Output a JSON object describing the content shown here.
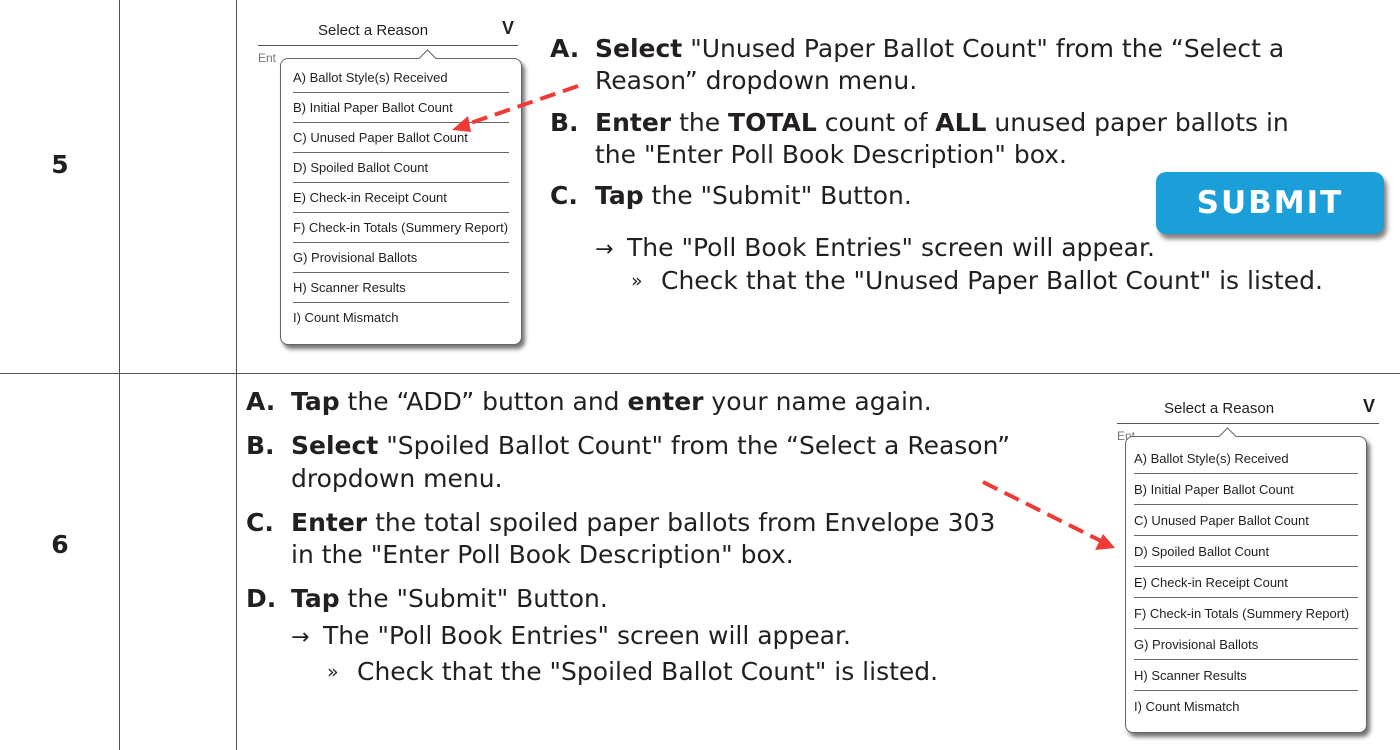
{
  "steps": [
    {
      "number": "5",
      "instructions": [
        {
          "letter": "A.",
          "html": "<b>Select</b> \"Unused Paper Ballot Count\" from the “Select a<br>Reason” dropdown menu."
        },
        {
          "letter": "B.",
          "html": "<b>Enter</b> the <b>TOTAL</b> count of <b>ALL</b> unused paper ballots in<br>the \"Enter Poll Book Description\" box."
        },
        {
          "letter": "C.",
          "html": "<b>Tap</b> the \"Submit\" Button."
        }
      ],
      "result_arrow": "→",
      "result": "The \"Poll Book Entries\" screen will appear.",
      "check_marker": "»",
      "check": "Check that the \"Unused Paper Ballot Count\" is listed.",
      "submit_label": "SUBMIT"
    },
    {
      "number": "6",
      "instructions": [
        {
          "letter": "A.",
          "html": "<b>Tap</b> the “ADD” button and <b>enter</b> your name again."
        },
        {
          "letter": "B.",
          "html": "<b>Select</b> \"Spoiled Ballot Count\" from the “Select a Reason”<br>dropdown menu."
        },
        {
          "letter": "C.",
          "html": "<b>Enter</b> the total spoiled paper ballots from Envelope 303<br>in the \"Enter Poll Book Description\" box."
        },
        {
          "letter": "D.",
          "html": "<b>Tap</b> the \"Submit\" Button."
        }
      ],
      "result_arrow": "→",
      "result": "The \"Poll Book Entries\" screen will appear.",
      "check_marker": "»",
      "check": "Check that the \"Spoiled Ballot Count\" is listed."
    }
  ],
  "dropdown": {
    "title": "Select a Reason",
    "chevron": "V",
    "entry_stub": "Ent",
    "options": [
      "A) Ballot Style(s) Received",
      "B) Initial Paper Ballot Count",
      "C) Unused Paper Ballot Count",
      "D) Spoiled Ballot Count",
      "E) Check-in Receipt Count",
      "F) Check-in Totals (Summery Report)",
      "G) Provisional Ballots",
      "H) Scanner Results",
      "I)  Count Mismatch"
    ]
  },
  "colors": {
    "pointer_arrow": "#ef3b36",
    "submit_button": "#1c9fd8",
    "text": "#231f20"
  }
}
